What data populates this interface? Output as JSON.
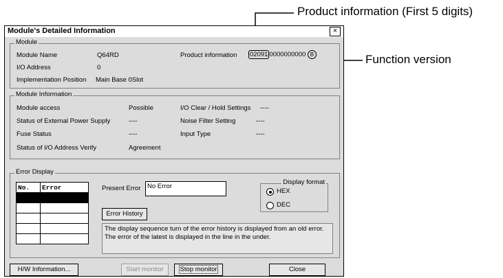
{
  "annotations": {
    "product_info": "Product information (First 5 digits)",
    "function_version": "Function version"
  },
  "dialog": {
    "title": "Module's Detailed Information",
    "close_glyph": "×"
  },
  "module": {
    "legend": "Module",
    "name_label": "Module Name",
    "name_value": "Q64RD",
    "io_address_label": "I/O Address",
    "io_address_value": "0",
    "impl_label": "Implementation Position",
    "impl_value": "Main Base  0Slot",
    "product_label": "Product information",
    "product_first5": "02091",
    "product_rest": "0000000000",
    "function_version": "B"
  },
  "module_information": {
    "legend": "Module Information",
    "rows": [
      {
        "label": "Module access",
        "value": "Possible"
      },
      {
        "label": "Status of External Power Supply",
        "value": "----"
      },
      {
        "label": "Fuse Status",
        "value": "----"
      },
      {
        "label": "Status of I/O Address Verify",
        "value": "Agreement"
      }
    ],
    "right_rows": [
      {
        "label": "I/O Clear / Hold Settings",
        "value": "----"
      },
      {
        "label": "Noise Filter Setting",
        "value": "----"
      },
      {
        "label": "Input Type",
        "value": "----"
      }
    ]
  },
  "error_display": {
    "legend": "Error Display",
    "col_no": "No.",
    "col_error": "Error",
    "present_error_label": "Present Error",
    "present_error_value": "No Error",
    "history_button": "Error History",
    "description": "The display sequence turn of the error history is displayed from an old error. The error of the latest is displayed in the line in the under.",
    "format_legend": "Display format",
    "hex_label": "HEX",
    "dec_label": "DEC",
    "selected_format": "HEX"
  },
  "buttons": {
    "hw_info": "H/W Information...",
    "start_monitor": "Start monitor",
    "stop_monitor": "Stop monitor",
    "close": "Close"
  }
}
